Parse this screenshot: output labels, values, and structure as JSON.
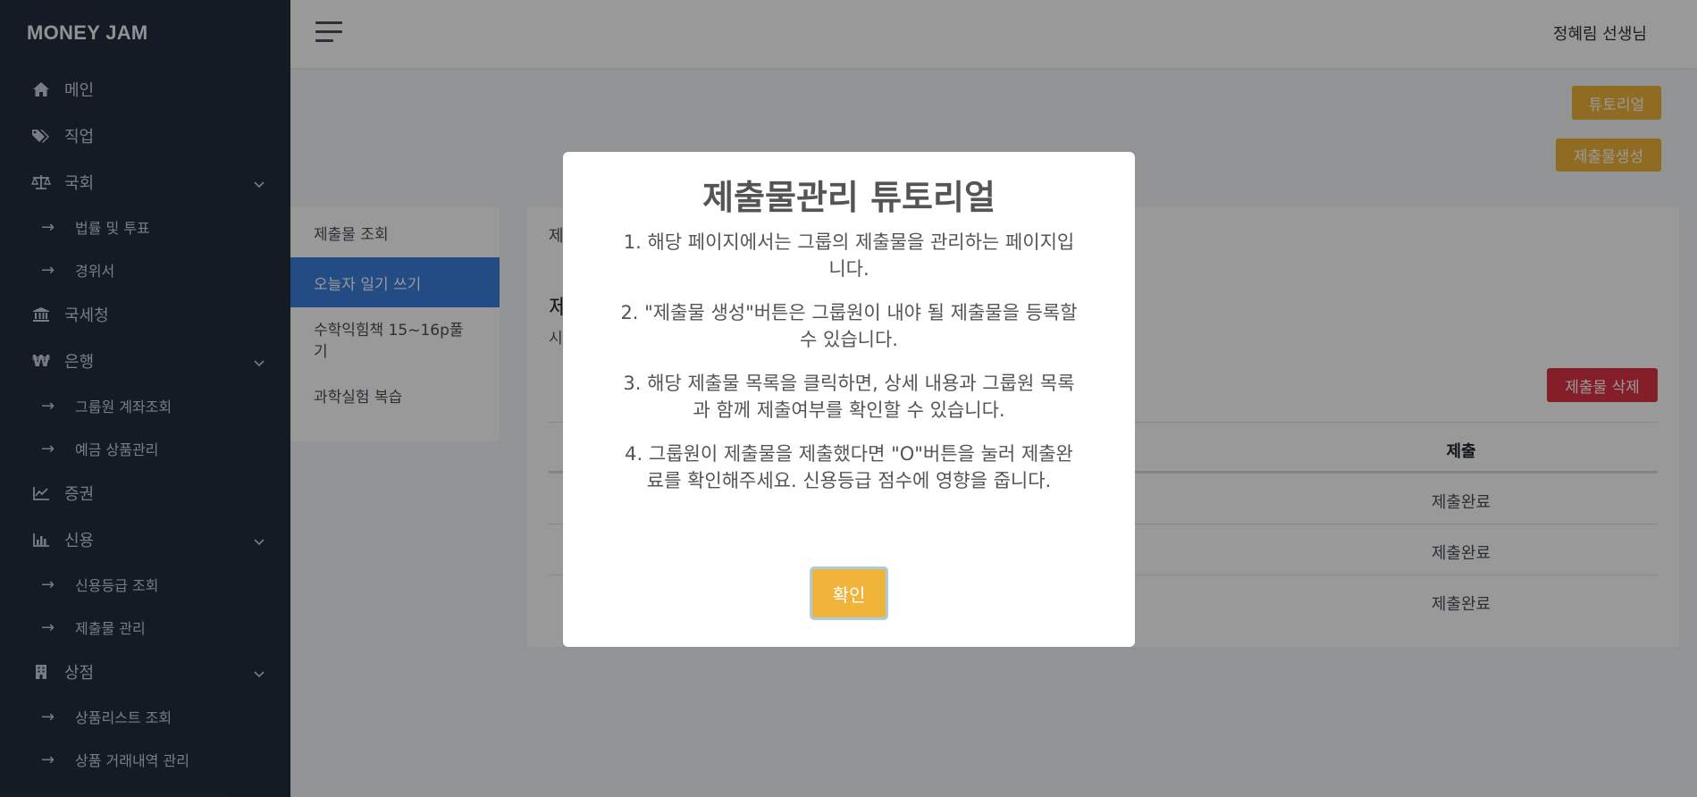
{
  "brand": "MONEY JAM",
  "header": {
    "user_name": "정혜림 선생님"
  },
  "sidebar": {
    "items": [
      {
        "label": "메인",
        "icon": "home-icon"
      },
      {
        "label": "직업",
        "icon": "tags-icon"
      },
      {
        "label": "국회",
        "icon": "balance-scale-icon",
        "expandable": true
      },
      {
        "label": "법률 및 투표",
        "sub": true
      },
      {
        "label": "경위서",
        "sub": true
      },
      {
        "label": "국세청",
        "icon": "bank-icon"
      },
      {
        "label": "은행",
        "icon": "won-icon",
        "expandable": true
      },
      {
        "label": "그룹원 계좌조회",
        "sub": true
      },
      {
        "label": "예금 상품관리",
        "sub": true
      },
      {
        "label": "증권",
        "icon": "line-chart-icon"
      },
      {
        "label": "신용",
        "icon": "bar-chart-icon",
        "expandable": true
      },
      {
        "label": "신용등급 조회",
        "sub": true
      },
      {
        "label": "제출물 관리",
        "sub": true
      },
      {
        "label": "상점",
        "icon": "building-icon",
        "expandable": true
      },
      {
        "label": "상품리스트 조회",
        "sub": true
      },
      {
        "label": "상품 거래내역 관리",
        "sub": true
      }
    ]
  },
  "toolbar": {
    "tutorial_label": "튜토리얼",
    "create_label": "제출물생성"
  },
  "submission_list": {
    "items": [
      {
        "label": "제출물 조회"
      },
      {
        "label": "오늘자 일기 쓰기",
        "active": true
      },
      {
        "label": "수학익힘책 15~16p풀기"
      },
      {
        "label": "과학실험 복습"
      }
    ]
  },
  "detail": {
    "title_partial": "제",
    "heading_partial": "제",
    "sub_partial": "시",
    "delete_label": "제출물 삭제",
    "column_header": "제출",
    "rows": [
      "제출완료",
      "제출완료",
      "제출완료"
    ]
  },
  "modal": {
    "title": "제출물관리 튜토리얼",
    "paragraphs": [
      "1. 해당 페이지에서는 그룹의 제출물을 관리하는 페이지입니다.",
      "2. \"제출물 생성\"버튼은 그룹원이 내야 될 제출물을 등록할 수 있습니다.",
      "3. 해당 제출물 목록을 클릭하면, 상세 내용과 그룹원 목록과 함께 제출여부를 확인할 수 있습니다.",
      "4. 그룹원이 제출물을 제출했다면 \"O\"버튼을 눌러 제출완료를 확인해주세요. 신용등급 점수에 영향을 줍니다."
    ],
    "confirm_label": "확인"
  },
  "colors": {
    "sidebar_bg": "#222e3c",
    "accent_yellow": "#f0b43a",
    "active_blue": "#3b7ddd",
    "danger_red": "#dc3545"
  }
}
